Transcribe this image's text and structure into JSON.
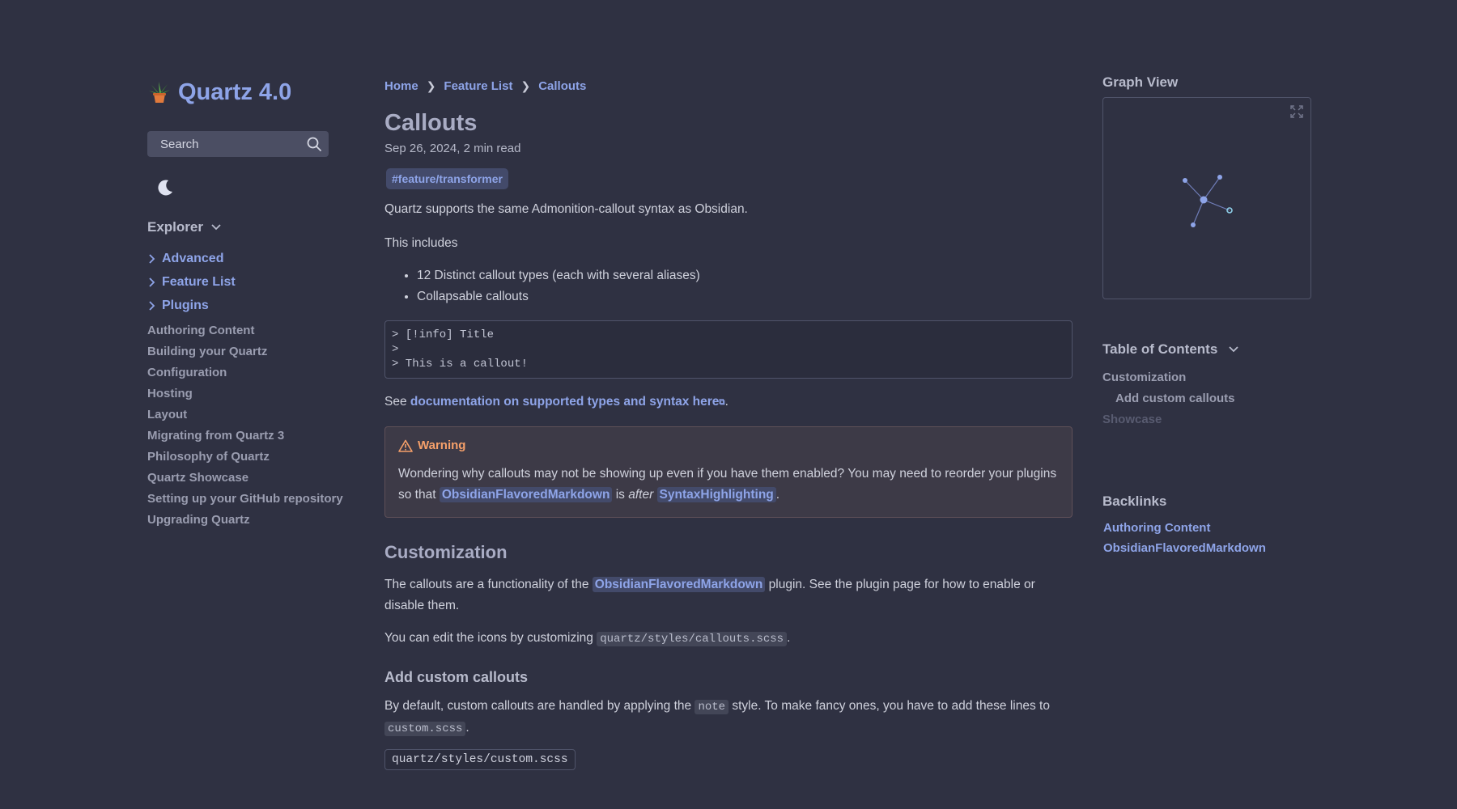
{
  "site": {
    "title": "Quartz 4.0"
  },
  "search": {
    "placeholder": "Search"
  },
  "explorer": {
    "title": "Explorer",
    "folders": [
      "Advanced",
      "Feature List",
      "Plugins"
    ],
    "files": [
      "Authoring Content",
      "Building your Quartz",
      "Configuration",
      "Hosting",
      "Layout",
      "Migrating from Quartz 3",
      "Philosophy of Quartz",
      "Quartz Showcase",
      "Setting up your GitHub repository",
      "Upgrading Quartz"
    ]
  },
  "breadcrumb": {
    "home": "Home",
    "sep": "❯",
    "feature_list": "Feature List",
    "current": "Callouts"
  },
  "article": {
    "title": "Callouts",
    "meta": "Sep 26, 2024,  2 min read",
    "tag": "#feature/transformer",
    "intro": "Quartz supports the same Admonition-callout syntax as Obsidian.",
    "includes": "This includes",
    "bullets": [
      "12 Distinct callout types (each with several aliases)",
      "Collapsable callouts"
    ],
    "code": "> [!info] Title\n>\n> This is a callout!",
    "see_prefix": "See ",
    "see_link": "documentation on supported types and syntax here",
    "see_suffix": ".",
    "warning": {
      "title": "Warning",
      "text_1": "Wondering why callouts may not be showing up even if you have them enabled? You may need to reorder your plugins so that ",
      "link_1": "ObsidianFlavoredMarkdown",
      "text_2": " is ",
      "em": "after",
      "text_3": " ",
      "link_2": "SyntaxHighlighting",
      "text_4": "."
    },
    "customization": {
      "heading": "Customization",
      "p1_a": "The callouts are a functionality of the ",
      "p1_link": "ObsidianFlavoredMarkdown",
      "p1_b": " plugin. See the plugin page for how to enable or disable them.",
      "p2_a": "You can edit the icons by customizing ",
      "p2_code": "quartz/styles/callouts.scss",
      "p2_b": "."
    },
    "custom_callouts": {
      "heading": "Add custom callouts",
      "p_a": "By default, custom callouts are handled by applying the ",
      "p_code1": "note",
      "p_b": " style. To make fancy ones, you have to add these lines to ",
      "p_code2": "custom.scss",
      "p_c": ".",
      "file_label": "quartz/styles/custom.scss"
    }
  },
  "graph": {
    "title": "Graph View"
  },
  "toc": {
    "title": "Table of Contents",
    "items": [
      "Customization",
      "Add custom callouts",
      "Showcase"
    ]
  },
  "backlinks": {
    "title": "Backlinks",
    "items": [
      "Authoring Content",
      "ObsidianFlavoredMarkdown"
    ]
  },
  "colors": {
    "background": "#2f3142",
    "accent": "#8ea4e8",
    "warning": "#f6a06a"
  }
}
